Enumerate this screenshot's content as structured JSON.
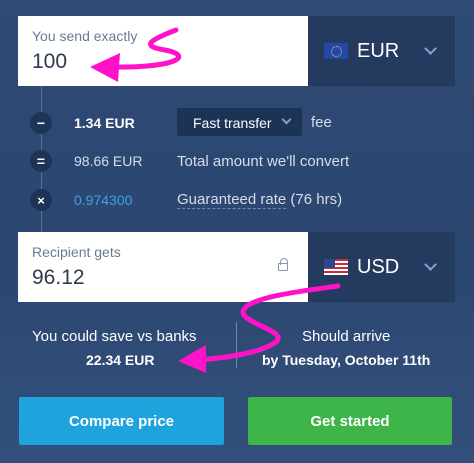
{
  "send": {
    "label": "You send exactly",
    "amount": "100",
    "currency": "EUR",
    "flag_icon": "eu-flag-icon"
  },
  "breakdown": {
    "fee_amount": "1.34 EUR",
    "fee_option": "Fast transfer",
    "fee_word": "fee",
    "convert_amount": "98.66 EUR",
    "convert_text": "Total amount we'll convert",
    "rate_value": "0.974300",
    "rate_text_link": "Guaranteed rate",
    "rate_text_rest": " (76 hrs)",
    "operators": [
      "−",
      "=",
      "×"
    ]
  },
  "receive": {
    "label": "Recipient gets",
    "amount": "96.12",
    "currency": "USD",
    "flag_icon": "us-flag-icon"
  },
  "summary": {
    "save_label": "You could save vs banks",
    "save_amount": "22.34 EUR",
    "arrive_label": "Should arrive",
    "arrive_date": "by Tuesday, October 11th"
  },
  "buttons": {
    "compare": "Compare price",
    "start": "Get started"
  },
  "colors": {
    "background": "#2f4a74",
    "accent_blue": "#1ea3dc",
    "accent_green": "#3db549",
    "rate_blue": "#3aa3e3",
    "annotation_magenta": "#ff12c8"
  }
}
